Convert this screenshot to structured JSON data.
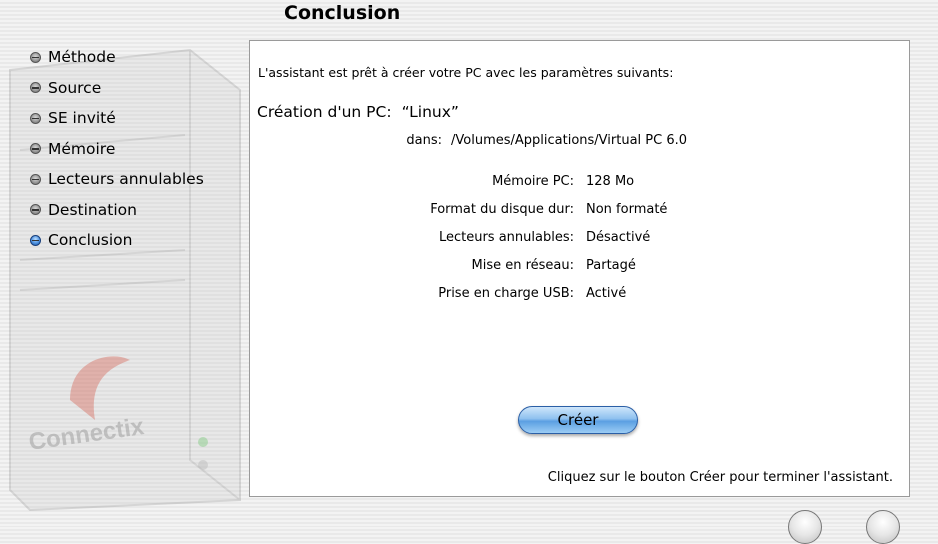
{
  "title": "Conclusion",
  "sidebar": {
    "steps": [
      {
        "label": "Méthode"
      },
      {
        "label": "Source"
      },
      {
        "label": "SE invité"
      },
      {
        "label": "Mémoire"
      },
      {
        "label": "Lecteurs annulables"
      },
      {
        "label": "Destination"
      },
      {
        "label": "Conclusion"
      }
    ],
    "brand": "Connectix"
  },
  "panel": {
    "intro": "L'assistant est prêt à créer votre PC avec les paramètres suivants:",
    "creation_label": "Création d'un PC:",
    "creation_name": "“Linux”",
    "dans_label": "dans:",
    "dans_value": "/Volumes/Applications/Virtual PC 6.0",
    "params": [
      {
        "label": "Mémoire PC:",
        "value": "128 Mo"
      },
      {
        "label": "Format du disque dur:",
        "value": "Non formaté"
      },
      {
        "label": "Lecteurs annulables:",
        "value": "Désactivé"
      },
      {
        "label": "Mise en réseau:",
        "value": "Partagé"
      },
      {
        "label": "Prise en charge USB:",
        "value": "Activé"
      }
    ],
    "create_button": "Créer",
    "footer": "Cliquez sur le bouton Créer pour terminer l'assistant."
  },
  "colors": {
    "active_step": "#3a7fd5",
    "button_blue": "#5b9fe2"
  }
}
